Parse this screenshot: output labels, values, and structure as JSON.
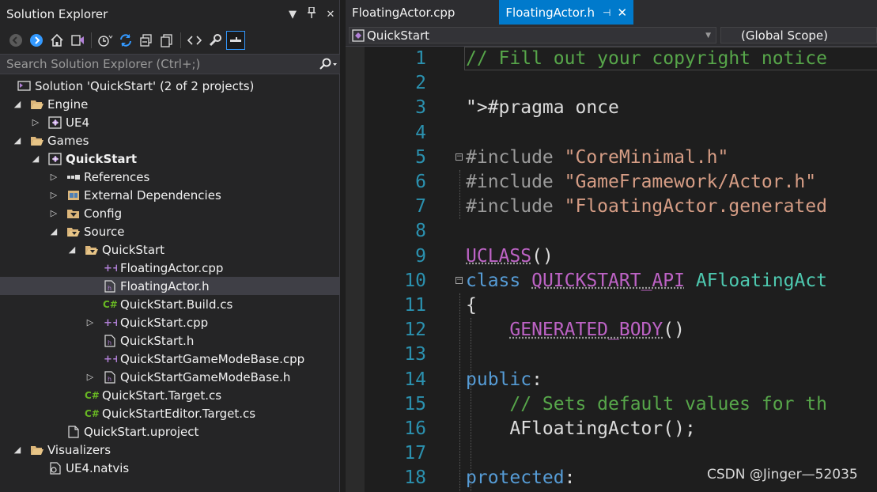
{
  "solution_explorer": {
    "title": "Solution Explorer",
    "search_placeholder": "Search Solution Explorer (Ctrl+;)",
    "tree": [
      {
        "label": "Solution 'QuickStart' (2 of 2 projects)",
        "icon": "solution-icon"
      },
      {
        "label": "Engine",
        "icon": "folder-open-icon"
      },
      {
        "label": "UE4",
        "icon": "project-icon"
      },
      {
        "label": "Games",
        "icon": "folder-open-icon"
      },
      {
        "label": "QuickStart",
        "icon": "project-icon"
      },
      {
        "label": "References",
        "icon": "references-icon"
      },
      {
        "label": "External Dependencies",
        "icon": "external-dependencies-icon"
      },
      {
        "label": "Config",
        "icon": "filter-folder-icon"
      },
      {
        "label": "Source",
        "icon": "filter-folder-open-icon"
      },
      {
        "label": "QuickStart",
        "icon": "filter-folder-open-icon"
      },
      {
        "label": "FloatingActor.cpp",
        "icon": "cpp-file-icon"
      },
      {
        "label": "FloatingActor.h",
        "icon": "header-file-icon"
      },
      {
        "label": "QuickStart.Build.cs",
        "icon": "csharp-file-icon"
      },
      {
        "label": "QuickStart.cpp",
        "icon": "cpp-file-icon"
      },
      {
        "label": "QuickStart.h",
        "icon": "header-file-icon"
      },
      {
        "label": "QuickStartGameModeBase.cpp",
        "icon": "cpp-file-icon"
      },
      {
        "label": "QuickStartGameModeBase.h",
        "icon": "header-file-icon"
      },
      {
        "label": "QuickStart.Target.cs",
        "icon": "csharp-file-icon"
      },
      {
        "label": "QuickStartEditor.Target.cs",
        "icon": "csharp-file-icon"
      },
      {
        "label": "QuickStart.uproject",
        "icon": "file-icon"
      },
      {
        "label": "Visualizers",
        "icon": "folder-open-icon"
      },
      {
        "label": "UE4.natvis",
        "icon": "natvis-file-icon"
      }
    ]
  },
  "editor": {
    "tabs": [
      {
        "label": "FloatingActor.cpp",
        "active": false
      },
      {
        "label": "FloatingActor.h",
        "active": true
      }
    ],
    "nav_class": "QuickStart",
    "nav_scope": "(Global Scope)",
    "lines": [
      {
        "n": "1",
        "text": "// Fill out your copyright notice"
      },
      {
        "n": "2",
        "text": ""
      },
      {
        "n": "3",
        "text": "#pragma once"
      },
      {
        "n": "4",
        "text": ""
      },
      {
        "n": "5",
        "text": "#include \"CoreMinimal.h\""
      },
      {
        "n": "6",
        "text": "#include \"GameFramework/Actor.h\""
      },
      {
        "n": "7",
        "text": "#include \"FloatingActor.generated"
      },
      {
        "n": "8",
        "text": ""
      },
      {
        "n": "9",
        "text": "UCLASS()"
      },
      {
        "n": "10",
        "text": "class QUICKSTART_API AFloatingAct"
      },
      {
        "n": "11",
        "text": "{"
      },
      {
        "n": "12",
        "text": "    GENERATED_BODY()"
      },
      {
        "n": "13",
        "text": ""
      },
      {
        "n": "14",
        "text": "public:"
      },
      {
        "n": "15",
        "text": "    // Sets default values for th"
      },
      {
        "n": "16",
        "text": "    AFloatingActor();"
      },
      {
        "n": "17",
        "text": ""
      },
      {
        "n": "18",
        "text": "protected:"
      }
    ]
  },
  "watermark": "CSDN @Jinger—52035"
}
